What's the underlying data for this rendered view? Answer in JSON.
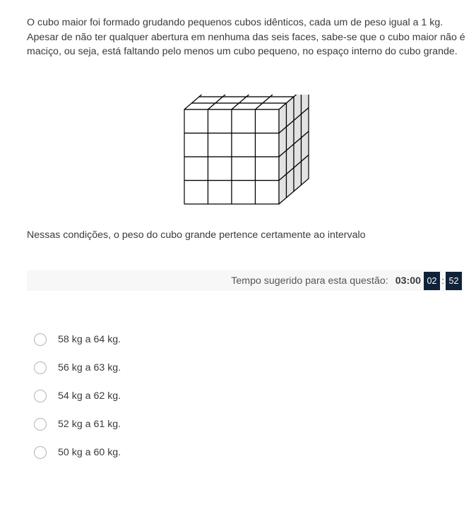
{
  "question": {
    "statement": "O cubo maior foi formado grudando pequenos cubos idênticos, cada um de peso igual a 1 kg. Apesar de não ter qualquer abertura em nenhuma das seis faces, sabe-se que o cubo maior não é maciço, ou seja, está faltando pelo menos um cubo pequeno, no espaço interno do cubo grande.",
    "prompt": "Nessas condições, o peso do cubo grande pertence certamente ao intervalo"
  },
  "figure": {
    "icon": "stacked-cubes-figure",
    "front_columns": 4,
    "front_rows": 4,
    "depth": 4
  },
  "timer": {
    "label": "Tempo sugerido para esta questão:",
    "suggested": "03:00",
    "minutes": "02",
    "separator": ":",
    "seconds": "52"
  },
  "options": [
    {
      "label": "58 kg a 64 kg."
    },
    {
      "label": "56 kg a 63 kg."
    },
    {
      "label": "54 kg a 62 kg."
    },
    {
      "label": "52 kg a 61 kg."
    },
    {
      "label": "50 kg a 60 kg."
    }
  ],
  "colors": {
    "timer_box": "#0f2238",
    "timer_bar": "#f7f7f7",
    "text": "#3a3a3a"
  }
}
